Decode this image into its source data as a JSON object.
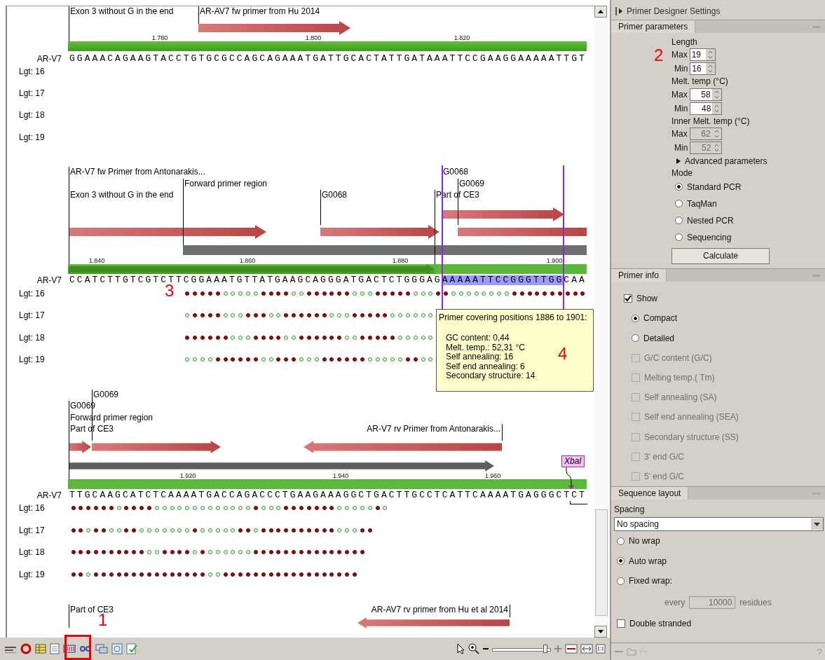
{
  "sequence_view": {
    "blocks": [
      {
        "features": [
          {
            "label": "Exon 3 without G in the end",
            "kind": "label"
          },
          {
            "label": "AR-AV7 fw primer from Hu 2014",
            "kind": "forward"
          }
        ],
        "ruler_ticks": [
          "1.780",
          "1.800",
          "1.820"
        ],
        "sequence_name": "AR-V7",
        "sequence": "GGAAACAGAAGTACCTGTGCGCCAGCAGAAATGATTGCACTATTGATAAATTCCGAAGGAAAAATTGT",
        "length_rows": [
          {
            "label": "Lgt: 16"
          },
          {
            "label": "Lgt: 17"
          },
          {
            "label": "Lgt: 18"
          },
          {
            "label": "Lgt: 19"
          }
        ]
      },
      {
        "features": [
          {
            "label": "AR-V7 fw Primer from Antonarakis...",
            "kind": "forward"
          },
          {
            "label": "G0068",
            "kind": "forward"
          },
          {
            "label": "Forward primer region",
            "kind": "region"
          },
          {
            "label": "G0069",
            "kind": "forward-cut"
          },
          {
            "label": "Exon 3 without G in the end",
            "kind": "exon"
          },
          {
            "label": "G0068",
            "kind": "forward"
          },
          {
            "label": "Part of CE3",
            "kind": "part"
          }
        ],
        "ruler_ticks": [
          "1.840",
          "1.860",
          "1.880",
          "1.900"
        ],
        "sequence_name": "AR-V7",
        "sequence": "CCATCTTGTCGTCTTCGGAAATGTTATGAAGCAGGGATGACTCTGGGAGAAAAATTCCGGGTTGGCAA",
        "length_rows": [
          {
            "label": "Lgt: 16",
            "dots": [
              true,
              true,
              true,
              true,
              true,
              false,
              false,
              false,
              false,
              false,
              true,
              true,
              true,
              true,
              false,
              false,
              true,
              true,
              true,
              true,
              true,
              true,
              false,
              false,
              false,
              true,
              true,
              true,
              true,
              true,
              false,
              false,
              false,
              true,
              true,
              false,
              false,
              false,
              false,
              false,
              false,
              false,
              false,
              true,
              true,
              true,
              true,
              true,
              true,
              true,
              true,
              true,
              true
            ]
          },
          {
            "label": "Lgt: 17",
            "dots": [
              false,
              true,
              true,
              true,
              true,
              false,
              false,
              false,
              true,
              true,
              true,
              false,
              false,
              true,
              true,
              true,
              true,
              true,
              true,
              false,
              false,
              false,
              true,
              true,
              true,
              true,
              true,
              false,
              false,
              false,
              false,
              false,
              false
            ]
          },
          {
            "label": "Lgt: 18",
            "dots": [
              true,
              true,
              true,
              true,
              true,
              true,
              false,
              false,
              false,
              true,
              true,
              true,
              true,
              false,
              false,
              true,
              true,
              true,
              true,
              true,
              true,
              false,
              false,
              true,
              true,
              true,
              true,
              true,
              false,
              false,
              false,
              false,
              false
            ]
          },
          {
            "label": "Lgt: 19",
            "dots": [
              false,
              false,
              false,
              false,
              true,
              true,
              true,
              true,
              true,
              true,
              false,
              false,
              true,
              true,
              true,
              false,
              false,
              false,
              true,
              true,
              true,
              true,
              true,
              true,
              false,
              false,
              false,
              false,
              false,
              true,
              true,
              false,
              false
            ]
          }
        ],
        "selection": {
          "tooltip": {
            "title": "Primer covering positions 1886 to 1901:",
            "lines": [
              "GC content: 0,44",
              "Melt. temp.: 52,31 °C",
              "Self annealing: 16",
              "Self end annealing: 6",
              "Secondary structure: 14"
            ]
          }
        }
      },
      {
        "features": [
          {
            "label": "G0069",
            "kind": "forward"
          },
          {
            "label": "G0069",
            "kind": "forward"
          },
          {
            "label": "Forward primer region",
            "kind": "region-arrow"
          },
          {
            "label": "Part of CE3",
            "kind": "part"
          },
          {
            "label": "AR-V7 rv Primer from Antonarakis...",
            "kind": "reverse"
          }
        ],
        "ruler_ticks": [
          "1.920",
          "1.940",
          "1.960"
        ],
        "sequence_name": "AR-V7",
        "sequence": "TTGCAAGCATCTCAAAATGACCAGACCCTGAAGAAAGGCTGACTTGCCTCATTCAAAATGAGGGCTCT",
        "restriction_site": {
          "label": "XbaI"
        },
        "length_rows": [
          {
            "label": "Lgt: 16",
            "dots": [
              true,
              true,
              true,
              true,
              true,
              true,
              false,
              true,
              true,
              true,
              true,
              false,
              false,
              false,
              false,
              false,
              false,
              false,
              false,
              false,
              false,
              false,
              false,
              false,
              true,
              false,
              false,
              false,
              true,
              true,
              true,
              true,
              true,
              true,
              true,
              false,
              false,
              false,
              false,
              false,
              true,
              false
            ]
          },
          {
            "label": "Lgt: 17",
            "dots": [
              true,
              true,
              false,
              true,
              true,
              false,
              false,
              true,
              true,
              false,
              false,
              false,
              false,
              false,
              false,
              false,
              true,
              false,
              false,
              false,
              false,
              false,
              true,
              true,
              false,
              true,
              true,
              true,
              true,
              true,
              true,
              true,
              true,
              true,
              true,
              false,
              false,
              false,
              true,
              true
            ]
          },
          {
            "label": "Lgt: 18",
            "dots": [
              true,
              true,
              true,
              true,
              true,
              true,
              true,
              true,
              true,
              true,
              false,
              false,
              true,
              true,
              true,
              true,
              false,
              true,
              false,
              false,
              false,
              false,
              false,
              false,
              true,
              true,
              true,
              true,
              true,
              true,
              true,
              true,
              true,
              true,
              true,
              true,
              true,
              true,
              true
            ]
          },
          {
            "label": "Lgt: 19",
            "dots": [
              true,
              true,
              false,
              true,
              true,
              true,
              true,
              true,
              true,
              true,
              true,
              true,
              true,
              true,
              true,
              true,
              true,
              true,
              false,
              false,
              true,
              true,
              true,
              true,
              true,
              true,
              true,
              true,
              true,
              true,
              true,
              true,
              true,
              true,
              true,
              true,
              true,
              true
            ]
          }
        ]
      },
      {
        "features": [
          {
            "label": "Part of CE3",
            "kind": "label"
          },
          {
            "label": "AR-AV7 rv primer from Hu et al 2014",
            "kind": "reverse"
          }
        ]
      }
    ]
  },
  "toolbar": {
    "zoom_slider": {
      "level": 0.95
    }
  },
  "settings_panel": {
    "title": "Primer Designer Settings",
    "primer_parameters": {
      "title": "Primer parameters",
      "groups": [
        {
          "label": "Length",
          "fields": [
            {
              "label": "Max",
              "value": "19",
              "disabled": false
            },
            {
              "label": "Min",
              "value": "16",
              "disabled": false
            }
          ]
        },
        {
          "label": "Melt. temp (°C)",
          "fields": [
            {
              "label": "Max",
              "value": "58",
              "disabled": false
            },
            {
              "label": "Min",
              "value": "48",
              "disabled": false
            }
          ]
        },
        {
          "label": "Inner Melt. temp (°C)",
          "fields": [
            {
              "label": "Max",
              "value": "62",
              "disabled": true
            },
            {
              "label": "Min",
              "value": "52",
              "disabled": true
            }
          ]
        }
      ],
      "advanced": {
        "label": "Advanced parameters",
        "expanded": false
      },
      "mode_label": "Mode",
      "modes": [
        {
          "label": "Standard PCR",
          "selected": true
        },
        {
          "label": "TaqMan",
          "selected": false
        },
        {
          "label": "Nested PCR",
          "selected": false
        },
        {
          "label": "Sequencing",
          "selected": false
        }
      ],
      "button": "Calculate"
    },
    "primer_info": {
      "title": "Primer info",
      "show": {
        "label": "Show",
        "checked": true
      },
      "styles": [
        {
          "label": "Compact",
          "selected": true
        },
        {
          "label": "Detailed",
          "selected": false
        }
      ],
      "options": [
        {
          "label": "G/C content (G/C)",
          "checked": false,
          "disabled": true
        },
        {
          "label": "Melting temp.( Tm)",
          "checked": false,
          "disabled": true
        },
        {
          "label": "Self annealing (SA)",
          "checked": false,
          "disabled": true
        },
        {
          "label": "Self end annealing (SEA)",
          "checked": false,
          "disabled": true
        },
        {
          "label": "Secondary structure (SS)",
          "checked": false,
          "disabled": true
        },
        {
          "label": "3' end G/C",
          "checked": false,
          "disabled": true
        },
        {
          "label": "5' end G/C",
          "checked": false,
          "disabled": true
        }
      ]
    },
    "sequence_layout": {
      "title": "Sequence layout",
      "spacing_label": "Spacing",
      "spacing": "No spacing",
      "wraps": [
        {
          "label": "No wrap",
          "selected": false
        },
        {
          "label": "Auto wrap",
          "selected": true
        },
        {
          "label": "Fixed wrap:",
          "selected": false
        }
      ],
      "every_label": "every",
      "every_value": "10000",
      "every_disabled": true,
      "residues_label": "residues",
      "double_stranded": {
        "label": "Double stranded",
        "checked": false
      }
    },
    "help": "?"
  },
  "callouts": [
    {
      "label": "2"
    },
    {
      "label": "3"
    },
    {
      "label": "4"
    },
    {
      "label": "1"
    }
  ]
}
